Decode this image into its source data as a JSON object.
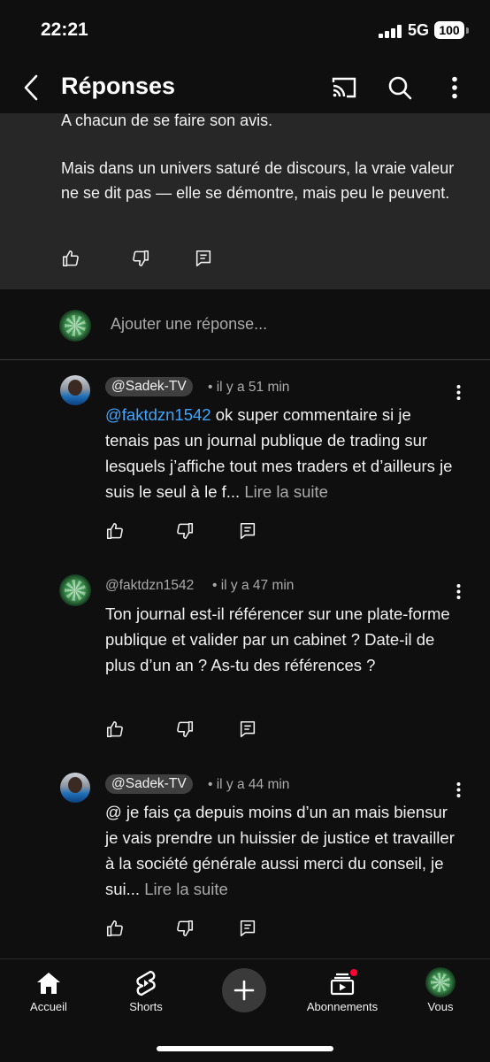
{
  "status_bar": {
    "time": "22:21",
    "network": "5G",
    "battery": "100"
  },
  "header": {
    "title": "Réponses"
  },
  "parent_comment": {
    "partial_line": "A chacun de se faire son avis.",
    "body": "Mais dans un univers saturé de discours, la vraie valeur ne se dit pas — elle se démontre, mais peu le peuvent."
  },
  "add_reply": {
    "placeholder": "Ajouter une réponse..."
  },
  "replies": [
    {
      "author": "@Sadek-TV",
      "meta": "• il y a 51 min",
      "mention": "@faktdzn1542",
      "text": " ok super commentaire si je tenais pas un journal publique de trading sur lesquels j’affiche tout mes traders et d’ailleurs je suis le seul à le f...",
      "read_more": "Lire la suite"
    },
    {
      "author": "@faktdzn1542",
      "meta": "• il y a 47 min",
      "text": "Ton journal est-il référencer sur une plate-forme publique et valider par un cabinet ? Date-il de plus d’un an ? As-tu des références ?"
    },
    {
      "author": "@Sadek-TV",
      "meta": "• il y a 44 min",
      "text": "@ je fais ça depuis moins d’un an mais biensur je vais prendre un huissier de justice et travailler à la société générale aussi merci du conseil, je sui...",
      "read_more": "Lire la suite"
    }
  ],
  "bottom_nav": {
    "items": [
      {
        "label": "Accueil",
        "icon": "home-icon"
      },
      {
        "label": "Shorts",
        "icon": "shorts-icon"
      },
      {
        "label": "Abonnements",
        "icon": "subscriptions-icon"
      },
      {
        "label": "Vous",
        "icon": "avatar"
      }
    ]
  },
  "colors": {
    "background": "#0f0f0f",
    "link": "#3ea6ff",
    "notification": "#ff0033"
  }
}
